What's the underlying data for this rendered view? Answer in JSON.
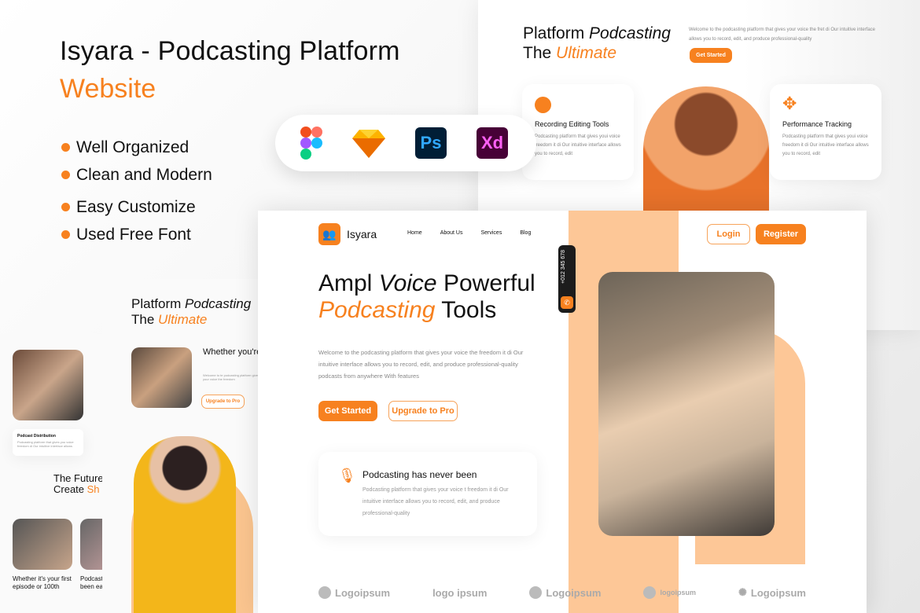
{
  "intro": {
    "title": "Isyara - Podcasting Platform",
    "subtitle": "Website",
    "features": [
      "Well Organized",
      "Clean and Modern",
      "Easy Customize",
      "Used Free Font"
    ],
    "tools": [
      {
        "name": "figma-icon"
      },
      {
        "name": "sketch-icon"
      },
      {
        "name": "photoshop-icon",
        "label": "Ps"
      },
      {
        "name": "xd-icon",
        "label": "Xd"
      }
    ]
  },
  "top_right": {
    "title_a": "Platform ",
    "title_b": "Podcasting",
    "title_c": "The ",
    "title_d": "Ultimate",
    "desc": "Welcome to the podcasting platform that gives your voice the fret di Our intuitive interface allows you to record, edit, and produce professional-quality",
    "cta": "Get Started",
    "cards": [
      {
        "title": "Recording Editing Tools",
        "text": "Podcasting platform that gives youi voice freedom it di Our intuitive interface allows you to record, edit"
      },
      {
        "title": "Performance Tracking",
        "text": "Podcasting platform that gives youi voice freedom it di Our intuitive interface allows you to record, edit"
      }
    ]
  },
  "main": {
    "brand": "Isyara",
    "nav": [
      "Home",
      "About Us",
      "Services",
      "Blog"
    ],
    "login": "Login",
    "register": "Register",
    "phone": "+012 345 678",
    "h_a": "Ampl ",
    "h_b": "Voice",
    "h_c": " Powerful",
    "h_d": "Podcasting",
    "h_e": " Tools",
    "desc": "Welcome to the podcasting platform that gives your voice the freedom it di Our intuitive interface allows you to record, edit, and produce professional-quality podcasts from anywhere With features",
    "get_started": "Get Started",
    "upgrade": "Upgrade to Pro",
    "info_title": "Podcasting has never been",
    "info_text": "Podcasting platform that gives your voice t freedom it di Our intuitive interface allows you to record, edit, and produce professional-quality",
    "logos": [
      "Logoipsum",
      "logo ipsum",
      "Logoipsum",
      "logoipsum",
      "Logoipsum"
    ]
  },
  "mid_panel": {
    "title_a": "Platform ",
    "title_b": "Podcasting",
    "title_c": "The ",
    "title_d": "Ultimate",
    "item_title": "Whether you're starting podcas",
    "item_text": "Welcome to te podcasting platform gives your voice the freedom",
    "item_btn": "Upgrade to Pro"
  },
  "left_panel": {
    "card_title": "Podcast Distribution",
    "card_text": "Podcasting platform that gives you voice freedom di Our intuitive interface allows",
    "section_a": "The Future",
    "section_b": "Create ",
    "section_c": "Sh",
    "item1": "Whether it's your first episode or 100th",
    "item2": "Podcasti been eas"
  }
}
